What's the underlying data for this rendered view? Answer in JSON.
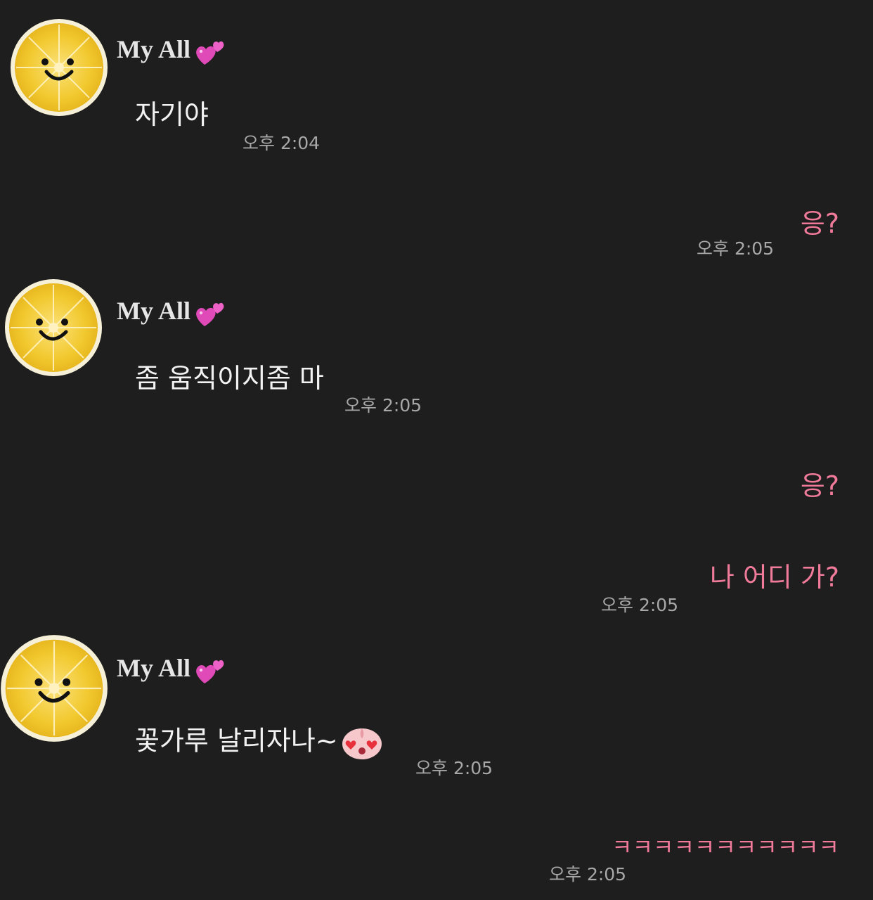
{
  "contact": {
    "name": "My All",
    "name_emoji": "two-hearts-icon"
  },
  "colors": {
    "background": "#1e1e1e",
    "received_text": "#f2f2f2",
    "sent_text": "#f07a9a",
    "timestamp": "#a8a8a8",
    "avatar_lemon": "#f3cd35"
  },
  "messages": [
    {
      "dir": "received",
      "text": "자기야",
      "time": "오후 2:04"
    },
    {
      "dir": "sent",
      "text": "응?",
      "time": "오후 2:05"
    },
    {
      "dir": "received",
      "text": "좀 움직이지좀 마",
      "time": "오후 2:05"
    },
    {
      "dir": "sent",
      "text": "응?",
      "time": ""
    },
    {
      "dir": "sent",
      "text": "나 어디 가?",
      "time": "오후 2:05"
    },
    {
      "dir": "received",
      "text": "꽃가루 날리자나~",
      "emoticon": "peach-heart-eyes-icon",
      "time": "오후 2:05"
    },
    {
      "dir": "sent",
      "text": "ㅋㅋㅋㅋㅋㅋㅋㅋㅋㅋㅋ",
      "time": "오후 2:05"
    }
  ]
}
